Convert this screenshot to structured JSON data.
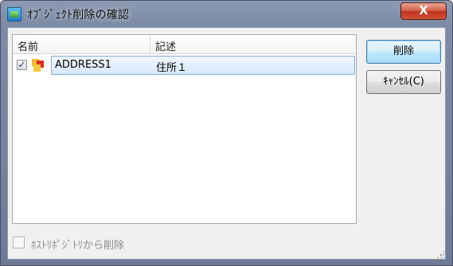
{
  "window": {
    "title": "ｵﾌﾞｼﾞｪｸﾄ削除の確認",
    "close_label": "X"
  },
  "list": {
    "columns": [
      "名前",
      "記述"
    ],
    "rows": [
      {
        "checked": true,
        "icon": "object-icon",
        "name": "ADDRESS1",
        "description": "住所１"
      }
    ]
  },
  "buttons": {
    "delete_label": "削除",
    "cancel_label": "ｷｬﾝｾﾙ(C)"
  },
  "options": {
    "remove_from_repository_label": "ﾎｽﾄﾘﾎﾟｼﾞﾄﾘから削除",
    "remove_from_repository_checked": false,
    "remove_from_repository_enabled": false
  },
  "colors": {
    "title_bar": "#7d8ba6",
    "selection": "#d7e7fb",
    "close_button": "#c0321b",
    "default_button_border": "#3c7fb1"
  }
}
